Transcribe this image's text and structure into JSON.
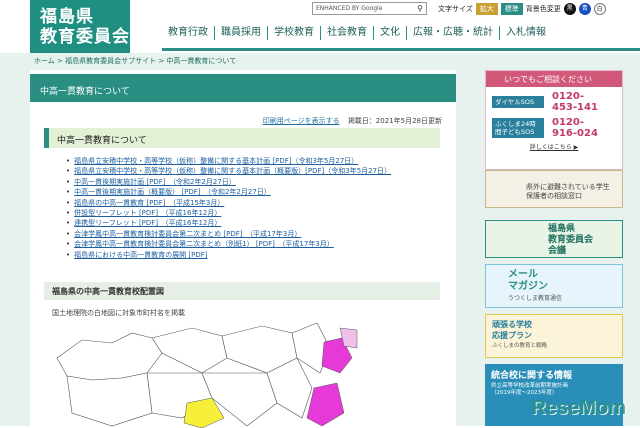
{
  "logo": {
    "line1": "福島県",
    "line2": "教育委員会"
  },
  "top": {
    "search_label": "ENHANCED BY Google",
    "text_size": "文字サイズ",
    "enlarge": "拡大",
    "standard": "標準",
    "bg_color": "背景色変更",
    "c_black": "黒",
    "c_blue": "青",
    "c_white": "白"
  },
  "nav": [
    "教育行政",
    "職員採用",
    "学校教育",
    "社会教育",
    "文化",
    "広報・広聴・統計",
    "入札情報"
  ],
  "breadcrumb": "ホーム > 福島県教育委員会サブサイト > 中高一貫教育について",
  "page": {
    "title": "中高一貫教育について",
    "print": "印刷用ページを表示する",
    "published": "掲載日：2021年5月28日更新",
    "section": "中高一貫教育について",
    "links": [
      "福島県立安積中学校・高等学校（仮称）整備に関する基本計画 [PDF]（令和3年5月27日）",
      "福島県立安積中学校・高等学校（仮称）整備に関する基本計画（概要版）[PDF]（令和3年5月27日）",
      "中高一貫後期実施計画 [PDF]　（令和2年2月27日）",
      "中高一貫後期実施計画（概要版） [PDF]　（令和2年2月27日）",
      "福島県の中高一貫教育 [PDF]　（平成15年3月）",
      "併設型リーフレット [PDF]　（平成16年12月）",
      "連携型リーフレット [PDF]　（平成16年12月）",
      "会津学鳳中高一貫教育検討委員会第二次まとめ [PDF]　（平成17年3月）",
      "会津学鳳中高一貫教育検討委員会第二次まとめ（別紙1） [PDF]　（平成17年3月）",
      "福島県における中高一貫教育の展開 [PDF]"
    ],
    "map_section": "福島県の中高一貫教育校配置図",
    "map_note": "国土地理院の白地図に対象市町村名を掲載"
  },
  "side": {
    "consult_head": "いつでもご相談ください",
    "sos1_label": "ダイヤルSOS",
    "sos1_num1": "0120-",
    "sos1_num2": "453-141",
    "sos2_label": "ふくしま24時間子どもSOS",
    "sos2_num1": "0120-",
    "sos2_num2": "916-024",
    "more": "詳しくはこちら ▶",
    "banner1": "県外に避難されている学生保護者の相談窓口",
    "banner2a": "福島県",
    "banner2b": "教育委員会",
    "banner2c": "会議",
    "banner3a": "メール",
    "banner3b": "マガジン",
    "banner3c": "うつくしま教育通信",
    "banner4a": "頑張る学校",
    "banner4b": "応援プラン",
    "banner4c": "ふくしまの教育と戦略",
    "banner5a": "統合校に関する情報",
    "banner5b": "県立高等学校改革前期実施計画（2019年度〜2023年度）"
  },
  "watermark": "ReseMom"
}
